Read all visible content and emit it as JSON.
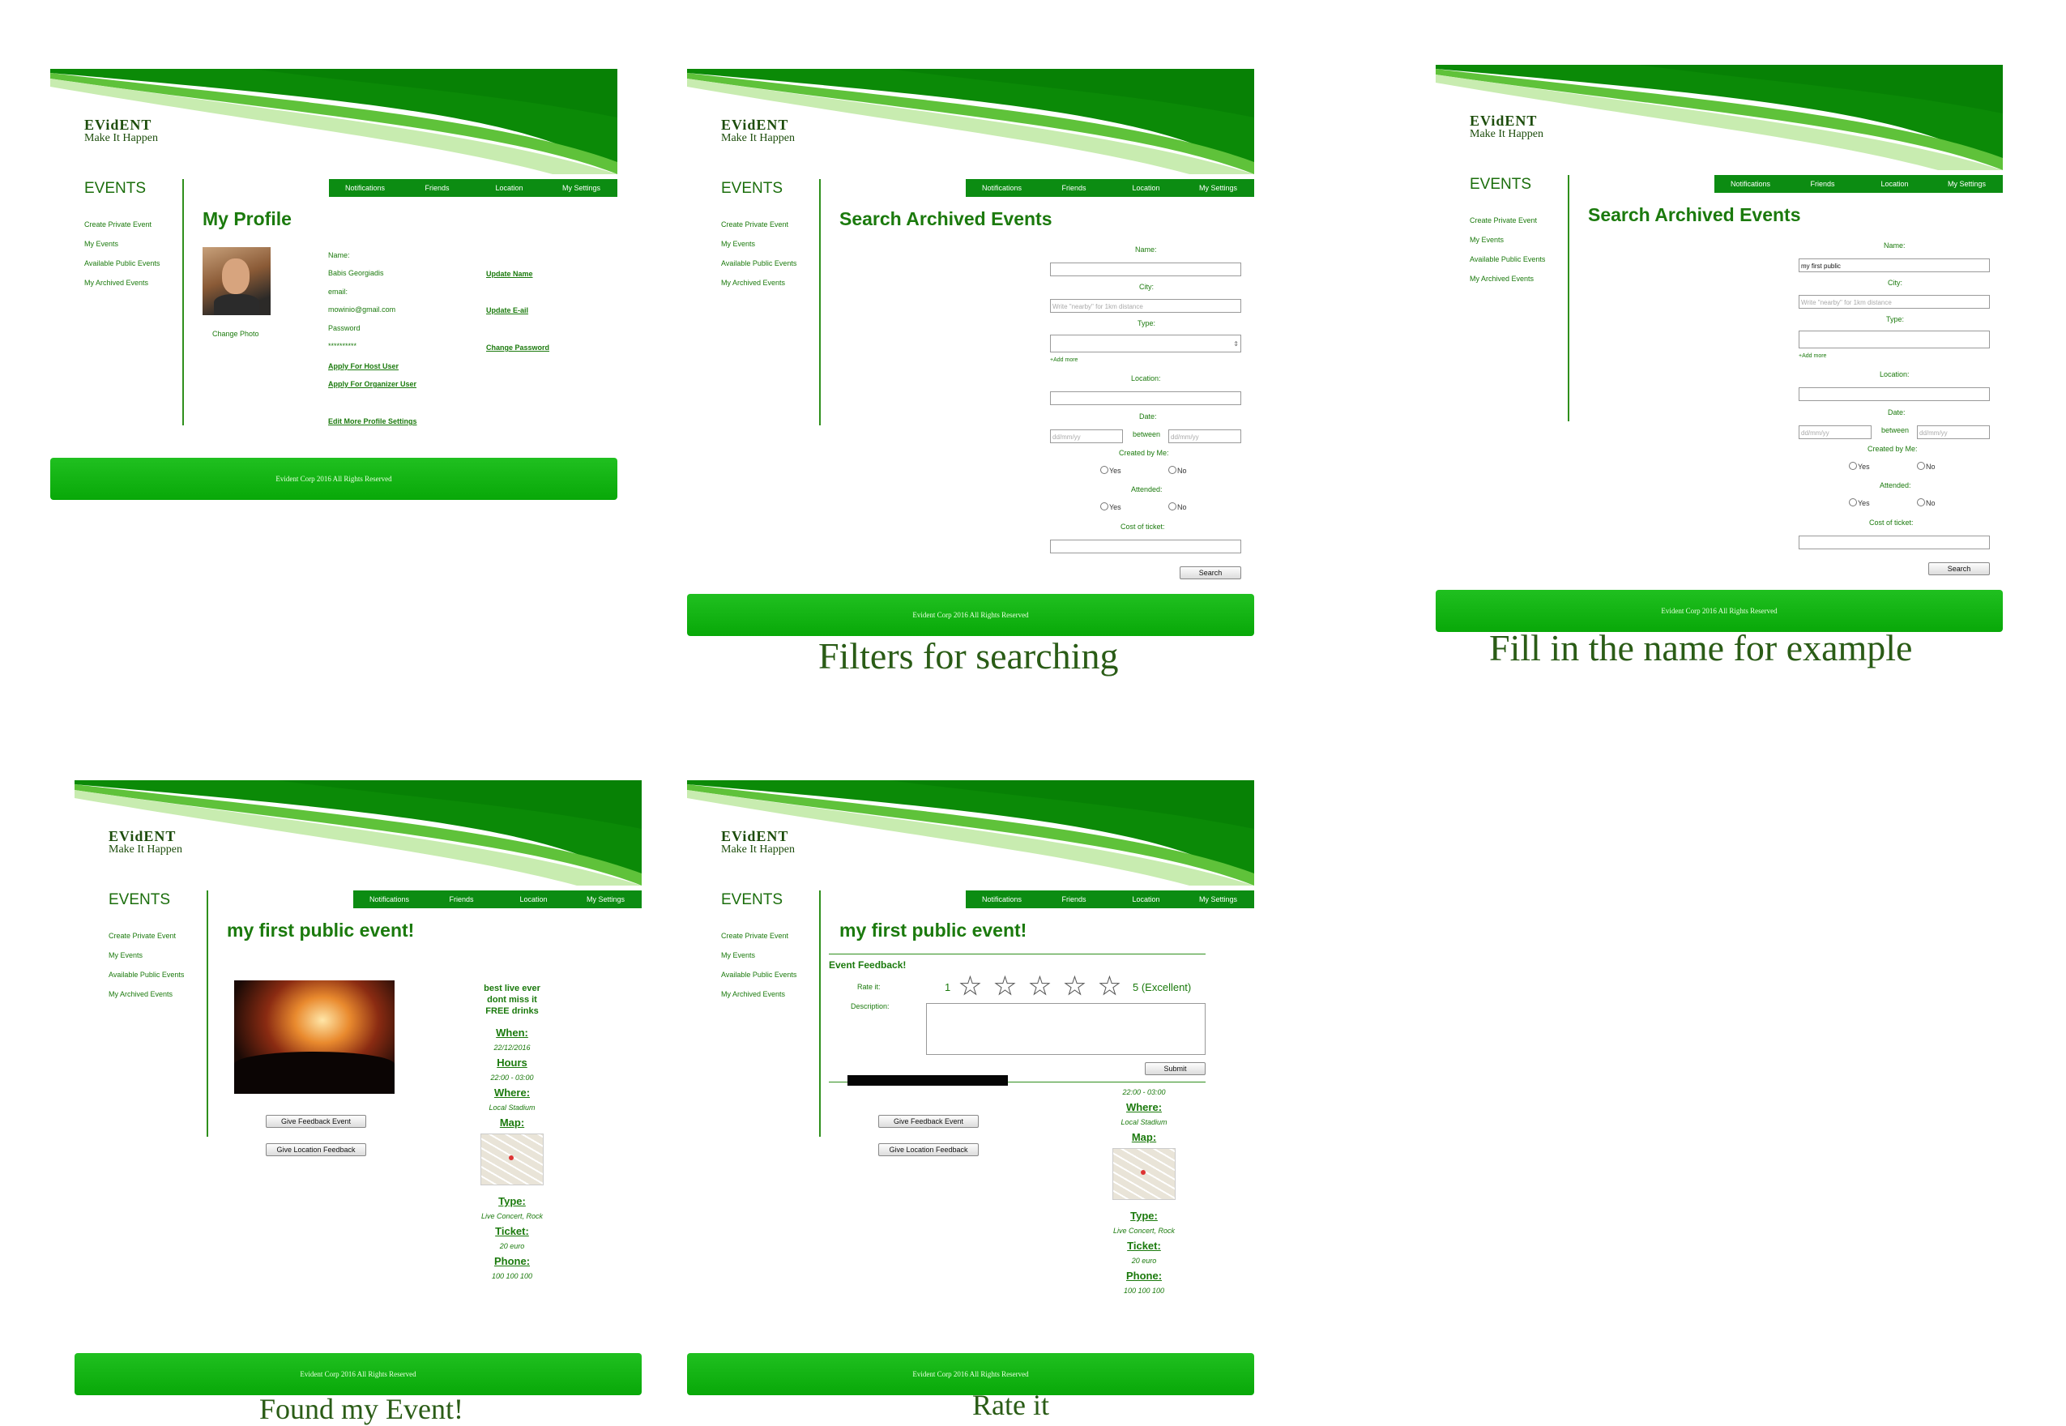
{
  "site": {
    "brand": "EVidENT",
    "tagline": "Make It Happen",
    "side_title": "EVENTS",
    "footer": "Evident Corp  2016 All Rights Reserved"
  },
  "sidebar": {
    "items": [
      "Create Private Event",
      "My Events",
      "Available Public Events",
      "My Archived Events"
    ]
  },
  "nav": {
    "items": [
      "Notifications",
      "Friends",
      "Location",
      "My Settings"
    ]
  },
  "profile": {
    "title": "My Profile",
    "change_photo": "Change Photo",
    "name_label": "Name:",
    "name_value": "Babis Georgiadis",
    "email_label": "email:",
    "email_value": "mowinio@gmail.com",
    "password_label": "Password",
    "password_value": "**********",
    "update_name": "Update Name",
    "update_email": "Update E-ail",
    "change_password": "Change Password",
    "apply_host": "Apply For Host User",
    "apply_organizer": "Apply For Organizer User",
    "edit_more": "Edit More Profile Settings"
  },
  "search": {
    "title": "Search Archived Events",
    "name_label": "Name:",
    "city_label": "City:",
    "city_placeholder": "Write \"nearby\" for 1km distance",
    "type_label": "Type:",
    "add_more": "+Add more",
    "location_label": "Location:",
    "date_label": "Date:",
    "date_placeholder": "dd/mm/yy",
    "between": "between",
    "created_label": "Created by Me:",
    "attended_label": "Attended:",
    "yes": "Yes",
    "no": "No",
    "cost_label": "Cost of ticket:",
    "search_button": "Search",
    "filled_name": "my first public"
  },
  "event": {
    "title": "my first public event!",
    "promo": [
      "best live ever",
      "dont miss it",
      "FREE drinks"
    ],
    "when_label": "When:",
    "when_value": "22/12/2016",
    "hours_label": "Hours",
    "hours_value": "22:00 - 03:00",
    "where_label": "Where:",
    "where_value": "Local Stadium",
    "map_label": "Map:",
    "type_label": "Type:",
    "type_value": "Live Concert, Rock",
    "ticket_label": "Ticket:",
    "ticket_value": "20 euro",
    "phone_label": "Phone:",
    "phone_value": "100 100 100",
    "give_feedback": "Give Feedback Event",
    "give_location": "Give Location Feedback"
  },
  "feedback": {
    "title": "Event Feedback!",
    "rate_label": "Rate it:",
    "min": "1",
    "max": "5 (Excellent)",
    "desc_label": "Description:",
    "submit": "Submit"
  },
  "captions": {
    "c2": "Filters for searching",
    "c3": "Fill in the name for example",
    "c4": "Found my Event!",
    "c5": "Rate it"
  }
}
